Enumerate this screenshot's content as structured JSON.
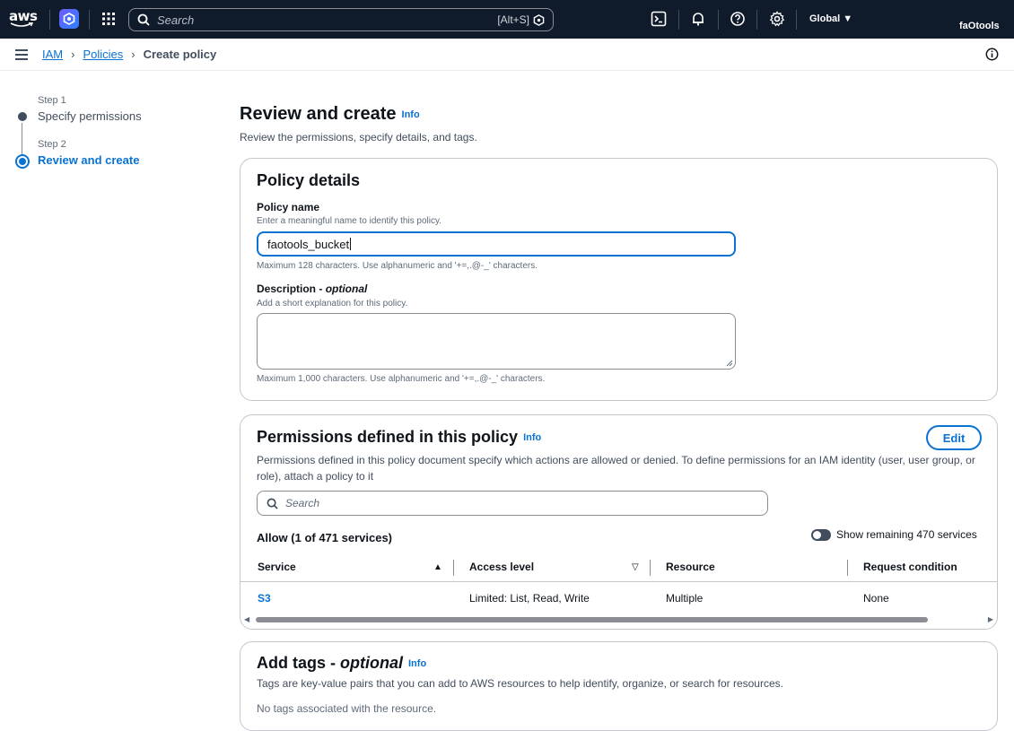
{
  "topnav": {
    "logo_text": "aws",
    "search_placeholder": "Search",
    "search_shortcut": "[Alt+S]",
    "region": "Global ▼",
    "account": "faOtools",
    "icons": [
      "cloudshell-icon",
      "bell-icon",
      "help-icon",
      "settings-icon"
    ]
  },
  "breadcrumb": {
    "items": [
      "IAM",
      "Policies",
      "Create policy"
    ]
  },
  "wizard": {
    "steps": [
      {
        "label": "Step 1",
        "title": "Specify permissions",
        "state": "complete"
      },
      {
        "label": "Step 2",
        "title": "Review and create",
        "state": "active"
      }
    ]
  },
  "page": {
    "title": "Review and create",
    "info": "Info",
    "description": "Review the permissions, specify details, and tags."
  },
  "policy_details": {
    "title": "Policy details",
    "name_label": "Policy name",
    "name_hint": "Enter a meaningful name to identify this policy.",
    "name_value": "faotools_bucket",
    "name_constraint": "Maximum 128 characters. Use alphanumeric and '+=,.@-_' characters.",
    "desc_label": "Description - ",
    "desc_optional": "optional",
    "desc_hint": "Add a short explanation for this policy.",
    "desc_value": "",
    "desc_constraint": "Maximum 1,000 characters. Use alphanumeric and '+=,.@-_' characters."
  },
  "permissions": {
    "title": "Permissions defined in this policy",
    "info": "Info",
    "edit_label": "Edit",
    "description": "Permissions defined in this policy document specify which actions are allowed or denied. To define permissions for an IAM identity (user, user group, or role), attach a policy to it",
    "search_placeholder": "Search",
    "allow_title": "Allow (1 of 471 services)",
    "toggle_label": "Show remaining 470 services",
    "toggle_on": false,
    "columns": [
      "Service",
      "Access level",
      "Resource",
      "Request condition"
    ],
    "rows": [
      {
        "service": "S3",
        "access_level": "Limited: List, Read, Write",
        "resource": "Multiple",
        "request_condition": "None"
      }
    ]
  },
  "tags": {
    "title": "Add tags - ",
    "title_optional": "optional",
    "info": "Info",
    "description": "Tags are key-value pairs that you can add to AWS resources to help identify, organize, or search for resources.",
    "empty": "No tags associated with the resource."
  },
  "colors": {
    "nav_bg": "#0f1b2a",
    "link": "#0972d3",
    "border": "#c6c6cd"
  }
}
